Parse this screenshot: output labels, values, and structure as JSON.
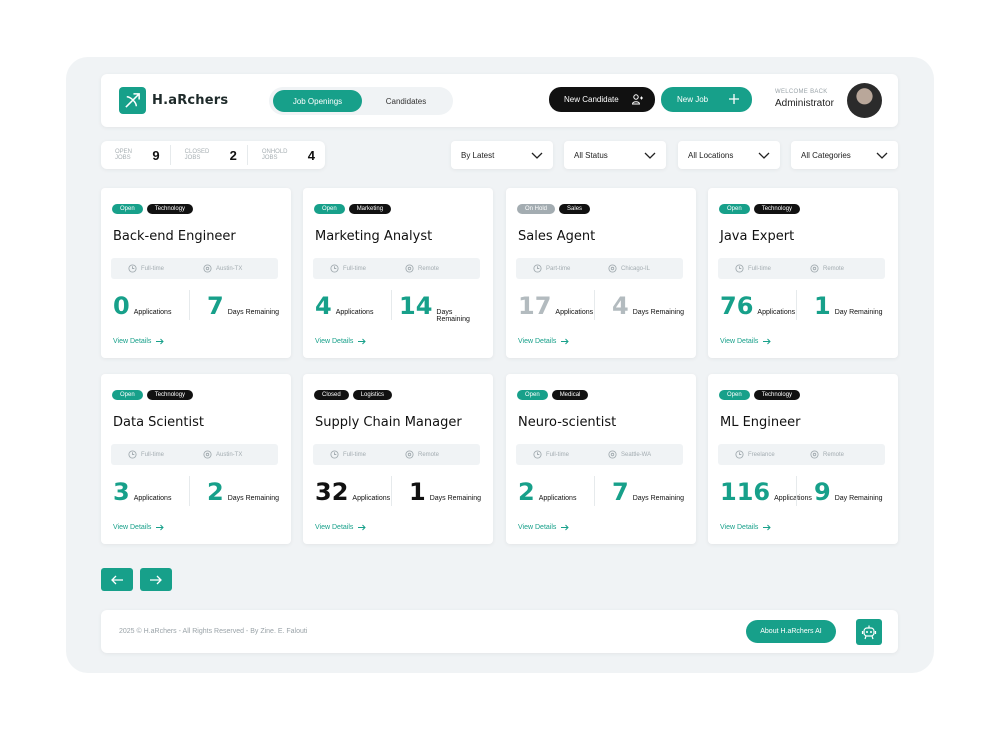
{
  "brand": {
    "name": "H.aRchers",
    "accent": "#17a08a"
  },
  "header": {
    "tabs": [
      {
        "label": "Job Openings"
      },
      {
        "label": "Candidates"
      }
    ],
    "new_candidate_label": "New Candidate",
    "new_job_label": "New Job",
    "welcome_label": "WELCOME BACK",
    "user_name": "Administrator"
  },
  "stats": [
    {
      "label": "OPEN JOBS",
      "value": "9"
    },
    {
      "label": "CLOSED JOBS",
      "value": "2"
    },
    {
      "label": "ONHOLD JOBS",
      "value": "4"
    }
  ],
  "filters": [
    {
      "value": "By Latest"
    },
    {
      "value": "All Status"
    },
    {
      "value": "All Locations"
    },
    {
      "value": "All Categories"
    }
  ],
  "jobs": [
    {
      "status": "Open",
      "category": "Technology",
      "title": "Back-end Engineer",
      "type": "Full-time",
      "location": "Austin-TX",
      "applications": "0",
      "applications_label": "Applications",
      "days": "7",
      "days_label": "Days Remaining",
      "details_label": "View Details"
    },
    {
      "status": "Open",
      "category": "Marketing",
      "title": "Marketing Analyst",
      "type": "Full-time",
      "location": "Remote",
      "applications": "4",
      "applications_label": "Applications",
      "days": "14",
      "days_label": "Days Remaining",
      "details_label": "View Details"
    },
    {
      "status": "On Hold",
      "category": "Sales",
      "title": "Sales Agent",
      "type": "Part-time",
      "location": "Chicago-IL",
      "applications": "17",
      "applications_label": "Applications",
      "days": "4",
      "days_label": "Days Remaining",
      "details_label": "View Details"
    },
    {
      "status": "Open",
      "category": "Technology",
      "title": "Java Expert",
      "type": "Full-time",
      "location": "Remote",
      "applications": "76",
      "applications_label": "Applications",
      "days": "1",
      "days_label": "Day Remaining",
      "details_label": "View Details"
    },
    {
      "status": "Open",
      "category": "Technology",
      "title": "Data Scientist",
      "type": "Full-time",
      "location": "Austin-TX",
      "applications": "3",
      "applications_label": "Applications",
      "days": "2",
      "days_label": "Days Remaining",
      "details_label": "View Details"
    },
    {
      "status": "Closed",
      "category": "Logistics",
      "title": "Supply Chain Manager",
      "type": "Full-time",
      "location": "Remote",
      "applications": "32",
      "applications_label": "Applications",
      "days": "1",
      "days_label": "Days Remaining",
      "details_label": "View Details"
    },
    {
      "status": "Open",
      "category": "Medical",
      "title": "Neuro-scientist",
      "type": "Full-time",
      "location": "Seattle-WA",
      "applications": "2",
      "applications_label": "Applications",
      "days": "7",
      "days_label": "Days Remaining",
      "details_label": "View Details"
    },
    {
      "status": "Open",
      "category": "Technology",
      "title": "ML Engineer",
      "type": "Freelance",
      "location": "Remote",
      "applications": "116",
      "applications_label": "Applications",
      "days": "9",
      "days_label": "Day Remaining",
      "details_label": "View Details"
    }
  ],
  "footer": {
    "copyright": "2025 © H.aRchers - All Rights Reserved - By Zine. E. Falouti",
    "about_label": "About H.aRchers AI"
  }
}
